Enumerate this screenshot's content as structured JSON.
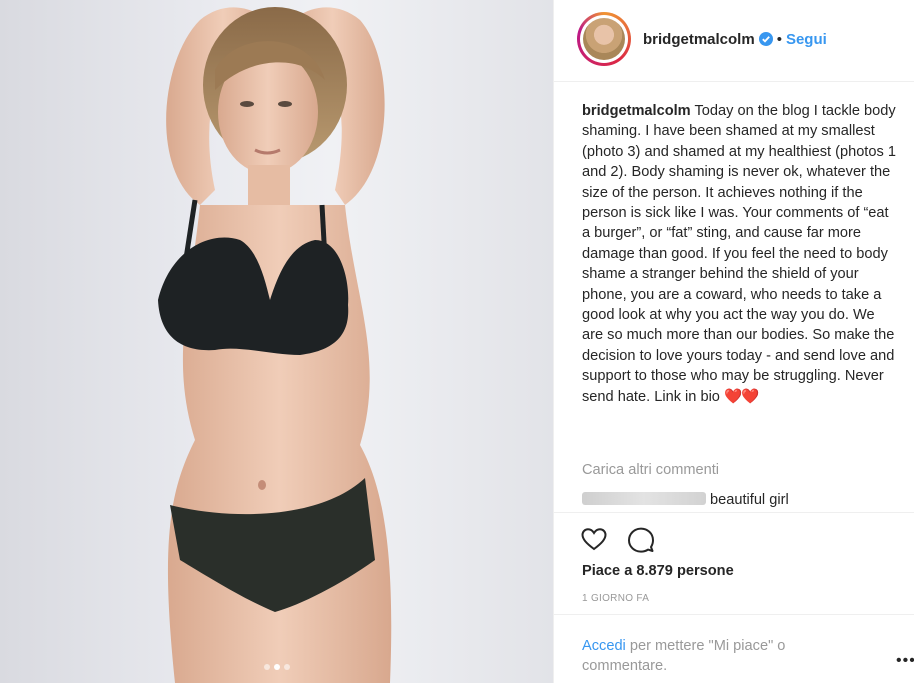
{
  "post": {
    "username": "bridgetmalcolm",
    "separator": "•",
    "follow_label": "Segui",
    "caption_user": "bridgetmalcolm",
    "caption_text": "Today on the blog I tackle body shaming. I have been shamed at my smallest (photo 3) and shamed at my healthiest (photos 1 and 2). Body shaming is never ok, whatever the size of the person. It achieves nothing if the person is sick like I was. Your comments of “eat a burger”, or “fat” sting, and cause far more damage than good. If you feel the need to body shame a stranger behind the shield of your phone, you are a coward, who needs to take a good look at why you act the way you do. We are so much more than our bodies. So make the decision to love yours today - and send love and support to those who may be struggling. Never send hate. Link in bio",
    "caption_emoji": "❤️❤️",
    "load_more": "Carica altri commenti",
    "comment_text": "beautiful girl",
    "likes": "Piace a 8.879 persone",
    "time": "1 GIORNO FA",
    "login_link": "Accedi",
    "login_rest": " per mettere \"Mi piace\" o commentare.",
    "more_options": "•••"
  },
  "carousel": {
    "slide_count": 3,
    "active_index": 1
  },
  "colors": {
    "link": "#3897f0",
    "verified": "#3897f0",
    "heart": "#e0243b",
    "muted": "#999999"
  },
  "icons": [
    "verified-badge-icon",
    "heart-icon",
    "comment-icon",
    "more-options-icon"
  ]
}
